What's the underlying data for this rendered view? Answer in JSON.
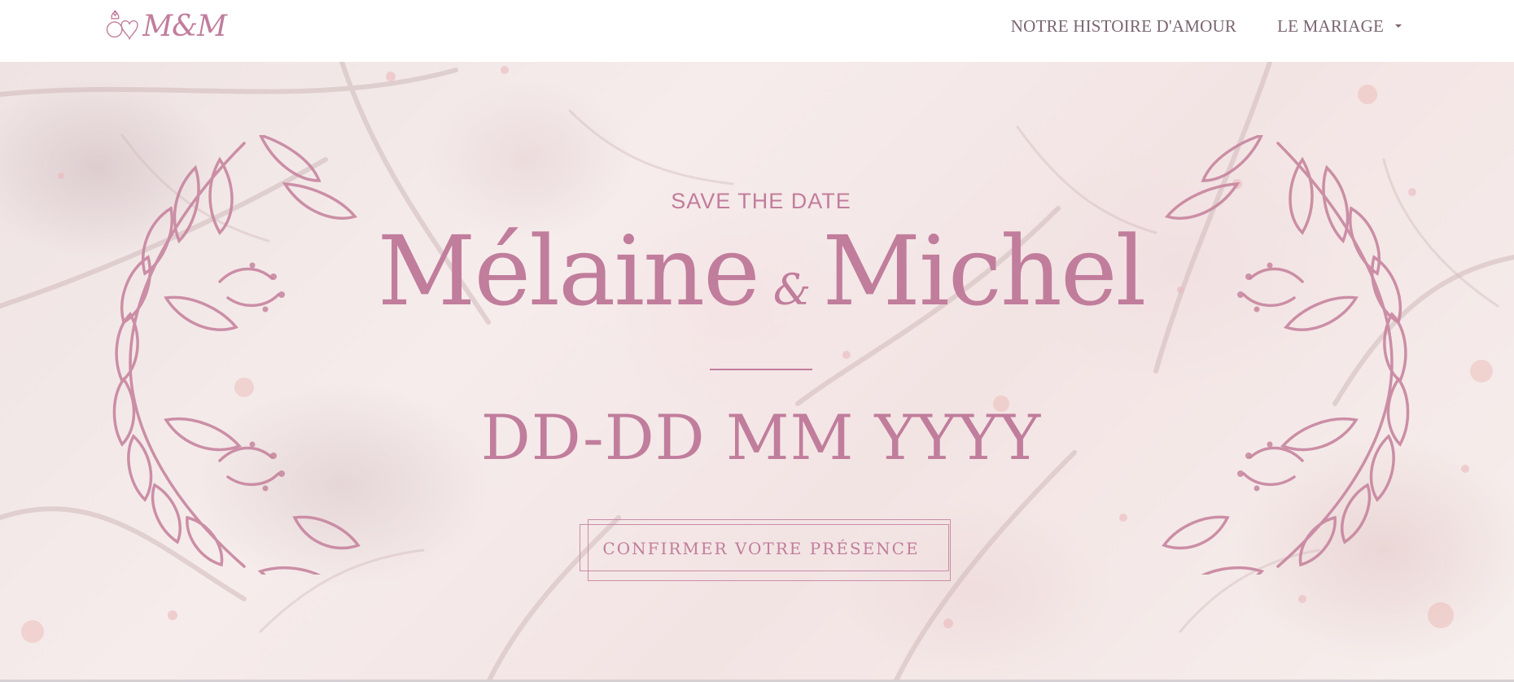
{
  "nav": {
    "logo_text": "M&M",
    "links": [
      {
        "label": "NOTRE HISTOIRE D'AMOUR"
      },
      {
        "label": "LE MARIAGE"
      }
    ]
  },
  "hero": {
    "eyebrow": "SAVE THE DATE",
    "bride": "Mélaine",
    "ampersand": "&",
    "groom": "Michel",
    "date": "DD-DD MM YYYY",
    "rsvp_label": "CONFIRMER VOTRE PRÉSENCE"
  },
  "colors": {
    "accent": "#c17d9c",
    "nav_text": "#7a6470",
    "background": "#f3e6e6"
  },
  "icons": [
    "rings-heart-icon",
    "caret-down-icon",
    "floral-wreath-icon"
  ]
}
